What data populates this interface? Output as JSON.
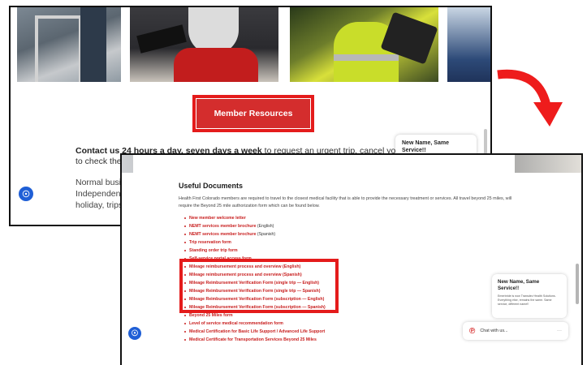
{
  "back_page": {
    "member_button_label": "Member Resources",
    "contact_bold": "Contact us 24 hours a day, seven days a week",
    "contact_rest": " to request an urgent trip, cancel your appointm",
    "contact_line2": "to check the",
    "normal_lines": [
      "Normal busin",
      "Independenc",
      "holiday, trips"
    ],
    "chat_preview_title": "New Name, Same Service!!"
  },
  "front_page": {
    "section_title": "Useful Documents",
    "intro_text": "Health First Colorado members are required to travel to the closest medical facility that is able to provide the necessary treatment or services.  All travel beyond 25 miles, will require the Beyond 25 mile authorization form which can be found below.",
    "documents": [
      {
        "label": "New member welcome letter",
        "suffix": ""
      },
      {
        "label": "NEMT services member brochure",
        "suffix": " (English)"
      },
      {
        "label": "NEMT services member brochure",
        "suffix": " (Spanish)"
      },
      {
        "label": "Trip reservation form",
        "suffix": ""
      },
      {
        "label": "Standing order trip form",
        "suffix": ""
      },
      {
        "label": "Self-service portal access form",
        "suffix": ""
      },
      {
        "label": "Mileage reimbursement process and overview (English)",
        "suffix": ""
      },
      {
        "label": "Mileage reimbursement process and overview (Spanish)",
        "suffix": ""
      },
      {
        "label": "Mileage Reimbursement Verification Form (single trip — English)",
        "suffix": ""
      },
      {
        "label": "Mileage Reimbursement Verification Form (single trip — Spanish)",
        "suffix": ""
      },
      {
        "label": "Mileage Reimbursement Verification Form (subscription — English)",
        "suffix": ""
      },
      {
        "label": "Mileage Reimbursement Verification Form (subscription — Spanish)",
        "suffix": ""
      },
      {
        "label": "Beyond 25 Miles form",
        "suffix": ""
      },
      {
        "label": "Level of service medical recommendation form",
        "suffix": ""
      },
      {
        "label": "Medical Certification for Basic Life Support / Advanced Life Support",
        "suffix": ""
      },
      {
        "label": "Medical Certificate for Transportation Services Beyond 25 Miles",
        "suffix": ""
      }
    ],
    "chat_card": {
      "title": "New Name, Same Service!!",
      "body": "Emerbride is now Transdev Health Solutions. Everything else, remains the same. Same service, different name!!"
    },
    "chat_bar_label": "Chat with us...",
    "chat_bar_more": "···"
  },
  "icons": {
    "accessibility": "accessibility-icon",
    "chat": "chat-bubble-icon",
    "arrow": "curved-arrow-icon"
  },
  "colors": {
    "accent_red": "#e41b1b",
    "button_red": "#d42d2d",
    "link_red": "#c81e1e",
    "access_blue": "#1f5fd6"
  }
}
